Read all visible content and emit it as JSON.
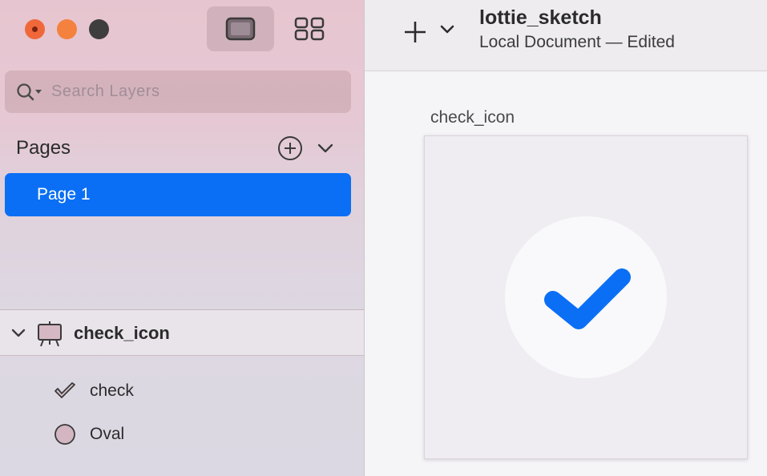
{
  "window": {
    "view_modes": [
      "canvas-view",
      "grid-view"
    ]
  },
  "sidebar": {
    "search": {
      "placeholder": "Search Layers",
      "value": ""
    },
    "pages": {
      "title": "Pages",
      "items": [
        {
          "label": "Page 1",
          "selected": true
        }
      ]
    },
    "layers": {
      "artboard": {
        "label": "check_icon",
        "expanded": true
      },
      "children": [
        {
          "label": "check",
          "icon": "check-shape-icon"
        },
        {
          "label": "Oval",
          "icon": "oval-icon"
        }
      ]
    }
  },
  "toolbar": {
    "doc_title": "lottie_sketch",
    "doc_subtitle": "Local Document — Edited"
  },
  "canvas": {
    "artboard_name": "check_icon"
  },
  "colors": {
    "accent": "#0a6ff5",
    "check": "#0a6ff5",
    "close": "#f0683a",
    "minimize": "#f5813e",
    "maximize": "#3e3e3e"
  }
}
